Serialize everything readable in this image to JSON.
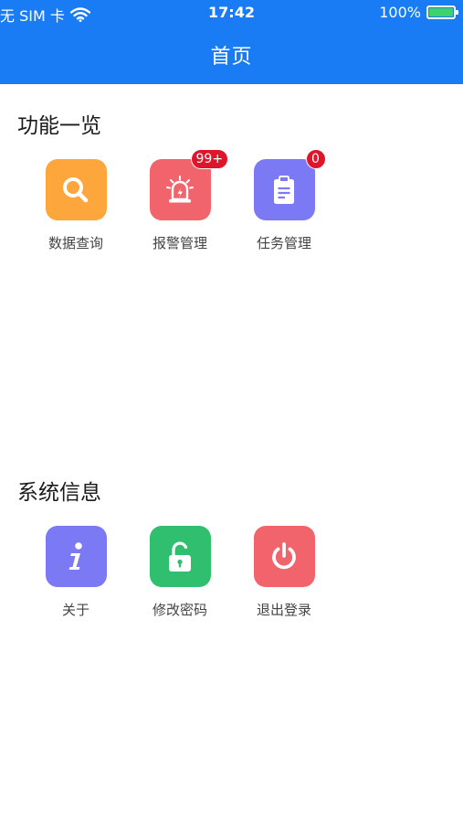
{
  "status_bar": {
    "carrier": "无 SIM 卡",
    "time": "17:42",
    "battery_percent": "100%",
    "battery_level": 1.0,
    "battery_color": "#3fd16a"
  },
  "navbar": {
    "title": "首页",
    "background": "#1a7cf5"
  },
  "features": {
    "title": "功能一览",
    "items": [
      {
        "label": "数据查询",
        "icon": "search-icon",
        "color": "#fca63c",
        "badge": ""
      },
      {
        "label": "报警管理",
        "icon": "alarm-light-icon",
        "color": "#f2646c",
        "badge": "99+"
      },
      {
        "label": "任务管理",
        "icon": "clipboard-icon",
        "color": "#7b79f4",
        "badge": "0"
      }
    ]
  },
  "system": {
    "title": "系统信息",
    "items": [
      {
        "label": "关于",
        "icon": "info-icon",
        "color": "#7b79f4"
      },
      {
        "label": "修改密码",
        "icon": "unlock-icon",
        "color": "#2fbf6e"
      },
      {
        "label": "退出登录",
        "icon": "power-icon",
        "color": "#f2646c"
      }
    ]
  }
}
